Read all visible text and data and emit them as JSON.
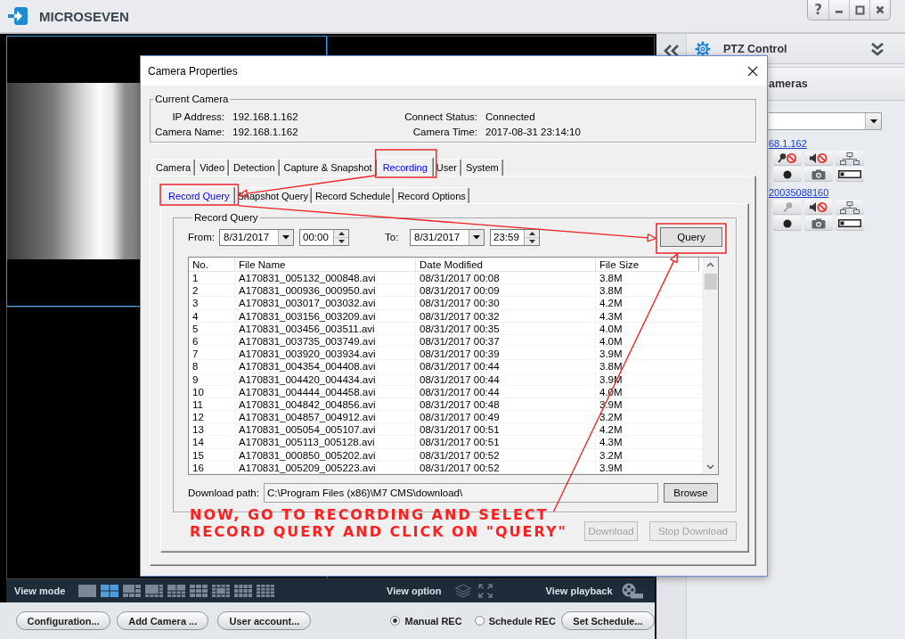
{
  "app": {
    "name": "MICROSEVEN",
    "help_label": "?"
  },
  "video_wall": {
    "cells": [
      {
        "selected": true,
        "has_video": true
      },
      {
        "selected": false,
        "has_video": false
      },
      {
        "selected": false,
        "has_video": false
      },
      {
        "selected": false,
        "has_video": false
      }
    ]
  },
  "view_bar": {
    "mode_label": "View mode",
    "modes": [
      {
        "kind": "single",
        "selected": false
      },
      {
        "kind": "quad",
        "selected": true
      },
      {
        "kind": "six",
        "selected": false
      },
      {
        "kind": "eight",
        "selected": false
      },
      {
        "kind": "ten",
        "selected": false
      },
      {
        "kind": "nine",
        "selected": false
      },
      {
        "kind": "thirteen",
        "selected": false
      },
      {
        "kind": "twelve",
        "selected": false
      },
      {
        "kind": "sixteen",
        "selected": false
      }
    ],
    "option_label": "View option",
    "playback_label": "View playback"
  },
  "bottom_bar": {
    "buttons": [
      "Configuration...",
      "Add Camera ...",
      "User account..."
    ],
    "record_modes": [
      {
        "label": "Manual REC",
        "selected": true
      },
      {
        "label": "Schedule REC",
        "selected": false
      }
    ],
    "schedule_button": "Set Schedule..."
  },
  "side_panel": {
    "title": "PTZ Control",
    "section_title": "ameras",
    "cameras": [
      {
        "address": "68.1.162",
        "mic_muted": true
      },
      {
        "address": "20035088160",
        "mic_muted": false
      }
    ]
  },
  "dialog": {
    "title": "Camera Properties",
    "current_camera": {
      "legend": "Current Camera",
      "fields": [
        {
          "label": "IP Address:",
          "value": "192.168.1.162"
        },
        {
          "label": "Connect Status:",
          "value": "Connected"
        },
        {
          "label": "Camera Name:",
          "value": "192.168.1.162"
        },
        {
          "label": "Camera Time:",
          "value": "2017-08-31 23:14:10"
        }
      ]
    },
    "tabs": [
      {
        "label": "Camera",
        "selected": false,
        "highlighted": false
      },
      {
        "label": "Video",
        "selected": false,
        "highlighted": false
      },
      {
        "label": "Detection",
        "selected": false,
        "highlighted": false
      },
      {
        "label": "Capture & Snapshot",
        "selected": false,
        "highlighted": false
      },
      {
        "label": "Recording",
        "selected": true,
        "highlighted": true
      },
      {
        "label": "User",
        "selected": false,
        "highlighted": false
      },
      {
        "label": "System",
        "selected": false,
        "highlighted": false
      }
    ],
    "subtabs": [
      {
        "label": "Record Query",
        "selected": true,
        "highlighted": true
      },
      {
        "label": "Snapshot Query",
        "selected": false,
        "highlighted": false
      },
      {
        "label": "Record Schedule",
        "selected": false,
        "highlighted": false
      },
      {
        "label": "Record Options",
        "selected": false,
        "highlighted": false
      }
    ],
    "record_query": {
      "legend": "Record Query",
      "from_label": "From:",
      "from_date": "8/31/2017",
      "from_time": "00:00",
      "to_label": "To:",
      "to_date": "8/31/2017",
      "to_time": "23:59",
      "query_button": {
        "label": "Query",
        "highlighted": true
      },
      "table": {
        "columns": [
          "No.",
          "File Name",
          "Date Modified",
          "File Size"
        ],
        "rows": [
          [
            "1",
            "A170831_005132_000848.avi",
            "08/31/2017 00:08",
            "3.8M"
          ],
          [
            "2",
            "A170831_000936_000950.avi",
            "08/31/2017 00:09",
            "3.8M"
          ],
          [
            "3",
            "A170831_003017_003032.avi",
            "08/31/2017 00:30",
            "4.2M"
          ],
          [
            "4",
            "A170831_003156_003209.avi",
            "08/31/2017 00:32",
            "4.3M"
          ],
          [
            "5",
            "A170831_003456_003511.avi",
            "08/31/2017 00:35",
            "4.0M"
          ],
          [
            "6",
            "A170831_003735_003749.avi",
            "08/31/2017 00:37",
            "4.0M"
          ],
          [
            "7",
            "A170831_003920_003934.avi",
            "08/31/2017 00:39",
            "3.9M"
          ],
          [
            "8",
            "A170831_004354_004408.avi",
            "08/31/2017 00:44",
            "3.8M"
          ],
          [
            "9",
            "A170831_004420_004434.avi",
            "08/31/2017 00:44",
            "3.9M"
          ],
          [
            "10",
            "A170831_004444_004458.avi",
            "08/31/2017 00:44",
            "4.0M"
          ],
          [
            "11",
            "A170831_004842_004856.avi",
            "08/31/2017 00:48",
            "3.9M"
          ],
          [
            "12",
            "A170831_004857_004912.avi",
            "08/31/2017 00:49",
            "3.2M"
          ],
          [
            "13",
            "A170831_005054_005107.avi",
            "08/31/2017 00:51",
            "4.2M"
          ],
          [
            "14",
            "A170831_005113_005128.avi",
            "08/31/2017 00:51",
            "4.3M"
          ],
          [
            "15",
            "A170831_000850_005202.avi",
            "08/31/2017 00:52",
            "3.2M"
          ],
          [
            "16",
            "A170831_005209_005223.avi",
            "08/31/2017 00:52",
            "3.9M"
          ]
        ]
      },
      "download_path": {
        "label": "Download path:",
        "value": "C:\\Program Files (x86)\\M7 CMS\\download\\"
      },
      "browse_button": "Browse"
    },
    "actions": [
      {
        "label": "Download",
        "disabled": true
      },
      {
        "label": "Stop Download",
        "disabled": true
      }
    ]
  },
  "annotation": {
    "lines": [
      "NOW, GO TO RECORDING AND SELECT",
      "RECORD QUERY AND CLICK ON \"QUERY\""
    ]
  }
}
